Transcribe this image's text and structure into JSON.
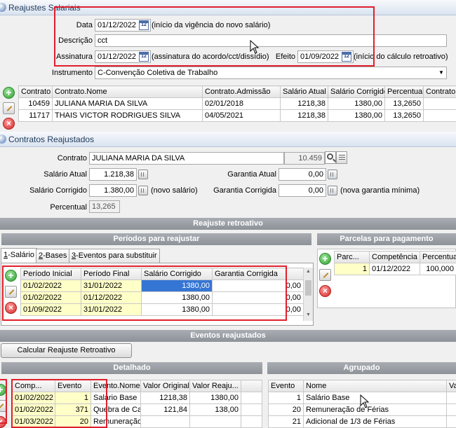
{
  "window1": {
    "title": "Reajustes Salariais"
  },
  "form": {
    "data_label": "Data",
    "data_value": "01/12/2022",
    "data_hint": "(início da vigência do novo salário)",
    "descricao_label": "Descrição",
    "descricao_value": "cct",
    "assinatura_label": "Assinatura",
    "assinatura_value": "01/12/2022",
    "assinatura_hint": "(assinatura do acordo/cct/dissídio)",
    "efeito_label": "Efeito",
    "efeito_value": "01/09/2022",
    "efeito_hint": "(início do cálculo retroativo)",
    "instrumento_label": "Instrumento",
    "instrumento_value": "C-Convenção Coletiva de Trabalho"
  },
  "contracts_table": {
    "columns": [
      "Contrato",
      "Contrato.Nome",
      "Contrato.Admissão",
      "Salário Atual",
      "Salário Corrigido",
      "Percentual",
      "Contrato"
    ],
    "rows": [
      [
        "10459",
        "JULIANA MARIA DA SILVA",
        "02/01/2018",
        "1218,38",
        "1380,00",
        "13,2650",
        ""
      ],
      [
        "11717",
        "THAIS VICTOR RODRIGUES SILVA",
        "04/05/2021",
        "1218,38",
        "1380,00",
        "13,2650",
        ""
      ]
    ]
  },
  "window2": {
    "title": "Contratos Reajustados"
  },
  "detail": {
    "contrato_label": "Contrato",
    "contrato_value": "JULIANA MARIA DA SILVA",
    "contrato_code": "10.459",
    "salario_atual_label": "Salário Atual",
    "salario_atual_value": "1.218,38",
    "garantia_atual_label": "Garantia Atual",
    "garantia_atual_value": "0,00",
    "salario_corrigido_label": "Salário Corrigido",
    "salario_corrigido_value": "1.380,00",
    "salario_corrigido_hint": "(novo salário)",
    "garantia_corrigida_label": "Garantia Corrigida",
    "garantia_corrigida_value": "0,00",
    "garantia_corrigida_hint": "(nova garantia mínima)",
    "percentual_label": "Percentual",
    "percentual_value": "13,265"
  },
  "sections": {
    "reajuste_retroativo": "Reajuste retroativo",
    "periodos": "Períodos para reajustar",
    "parcelas": "Parcelas para pagamento",
    "eventos_reajustados": "Eventos reajustados",
    "detalhado": "Detalhado",
    "agrupado": "Agrupado"
  },
  "tabs": [
    {
      "num": "1",
      "label": "-Salário"
    },
    {
      "num": "2",
      "label": "-Bases"
    },
    {
      "num": "3",
      "label": "-Eventos para substituir"
    }
  ],
  "periods_table": {
    "columns": [
      "Período Inicial",
      "Período Final",
      "Salário Corrigido",
      "Garantia Corrigida"
    ],
    "rows": [
      [
        "01/02/2022",
        "31/01/2022",
        "1380,00",
        "0,00"
      ],
      [
        "01/02/2022",
        "01/12/2022",
        "1380,00",
        "0,00"
      ],
      [
        "01/09/2022",
        "31/01/2022",
        "1380,00",
        "0,00"
      ]
    ]
  },
  "parcelas_table": {
    "columns": [
      "Parc...",
      "Competência",
      "Percentual"
    ],
    "rows": [
      [
        "1",
        "01/12/2022",
        "100,000"
      ]
    ]
  },
  "buttons": {
    "calcular": "Calcular Reajuste Retroativo"
  },
  "detalhado_table": {
    "columns": [
      "Comp...",
      "Evento",
      "Evento.Nome",
      "Valor Original",
      "Valor Reaju..."
    ],
    "rows": [
      [
        "01/02/2022",
        "1",
        "Salário Base",
        "1218,38",
        "1380,00"
      ],
      [
        "01/02/2022",
        "371",
        "Quebra de Cai",
        "121,84",
        "138,00"
      ],
      [
        "01/03/2022",
        "20",
        "Remuneração",
        "",
        ""
      ]
    ]
  },
  "agrupado_table": {
    "columns": [
      "Evento",
      "Nome",
      "Val"
    ],
    "rows": [
      [
        "1",
        "Salário Base",
        ""
      ],
      [
        "20",
        "Remuneração de Férias",
        ""
      ],
      [
        "21",
        "Adicional de 1/3 de Férias",
        ""
      ]
    ]
  }
}
